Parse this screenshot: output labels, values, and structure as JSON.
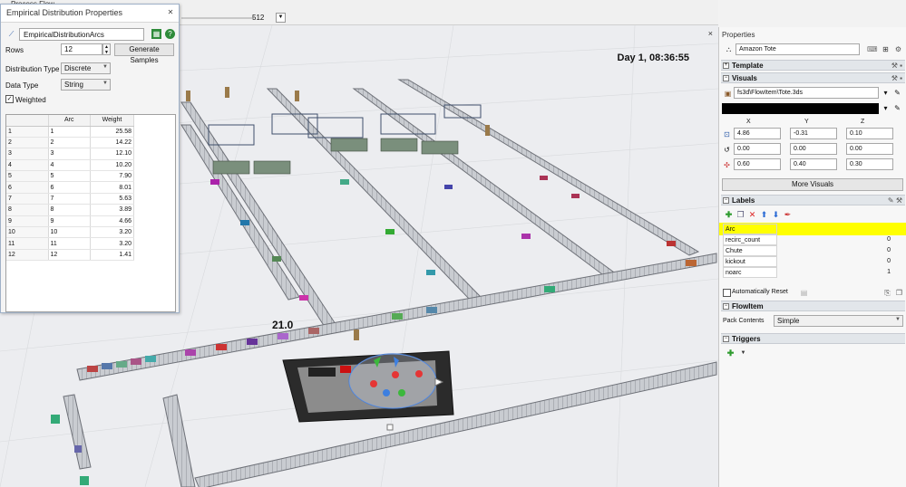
{
  "top_bar": {
    "tab_title": "Process Flow",
    "speed_value": "512"
  },
  "viewport": {
    "clock": "Day 1, 08:36:55",
    "close_glyph": "×",
    "overlay_label": "21.0"
  },
  "dialog": {
    "title": "Empirical Distribution Properties",
    "name_value": "EmpiricalDistributionArcs",
    "rows_label": "Rows",
    "rows_value": "12",
    "generate_button": "Generate Samples",
    "distribution_type_label": "Distribution Type",
    "distribution_type_value": "Discrete",
    "data_type_label": "Data Type",
    "data_type_value": "String",
    "weighted_label": "Weighted",
    "weighted_checked": true,
    "grid": {
      "columns": [
        "Arc",
        "Weight"
      ],
      "rows": [
        {
          "row": "1",
          "arc": "1",
          "weight": "25.58"
        },
        {
          "row": "2",
          "arc": "2",
          "weight": "14.22"
        },
        {
          "row": "3",
          "arc": "3",
          "weight": "12.10"
        },
        {
          "row": "4",
          "arc": "4",
          "weight": "10.20"
        },
        {
          "row": "5",
          "arc": "5",
          "weight": "7.90"
        },
        {
          "row": "6",
          "arc": "6",
          "weight": "8.01"
        },
        {
          "row": "7",
          "arc": "7",
          "weight": "5.63"
        },
        {
          "row": "8",
          "arc": "8",
          "weight": "3.89"
        },
        {
          "row": "9",
          "arc": "9",
          "weight": "4.66"
        },
        {
          "row": "10",
          "arc": "10",
          "weight": "3.20"
        },
        {
          "row": "11",
          "arc": "11",
          "weight": "3.20"
        },
        {
          "row": "12",
          "arc": "12",
          "weight": "1.41"
        }
      ]
    }
  },
  "properties": {
    "header": "Properties",
    "object_name": "Amazon Tote",
    "sections": {
      "template": "Template",
      "visuals": "Visuals",
      "labels": "Labels",
      "flowitem": "FlowItem",
      "triggers": "Triggers"
    },
    "visuals": {
      "shape_file": "fs3d\\FlowItem\\Tote.3ds",
      "color_hex": "#000000",
      "headers": [
        "X",
        "Y",
        "Z"
      ],
      "position": [
        "4.86",
        "-0.31",
        "0.10"
      ],
      "rotation": [
        "0.00",
        "0.00",
        "0.00"
      ],
      "size": [
        "0.60",
        "0.40",
        "0.30"
      ],
      "more_visuals": "More Visuals"
    },
    "labels": {
      "rows": [
        {
          "name": "Arc",
          "value": ""
        },
        {
          "name": "recirc_count",
          "value": "0"
        },
        {
          "name": "Chute",
          "value": "0"
        },
        {
          "name": "kickout",
          "value": "0"
        },
        {
          "name": "noarc",
          "value": "1"
        }
      ],
      "auto_reset": "Automatically Reset",
      "highlight_color": "#ffff00"
    },
    "flowitem": {
      "pack_contents_label": "Pack Contents",
      "pack_contents_value": "Simple"
    }
  }
}
